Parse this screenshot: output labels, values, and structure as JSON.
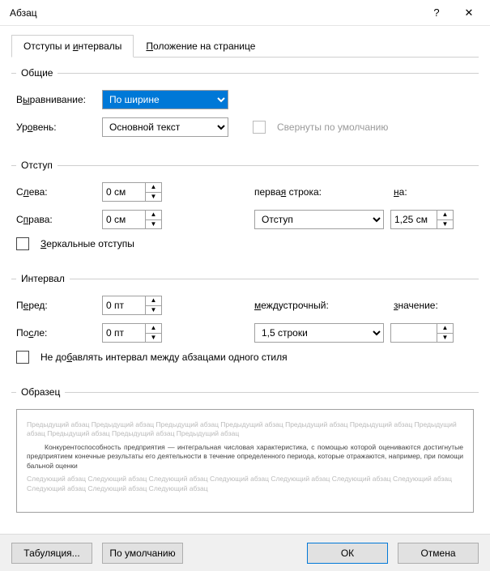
{
  "titlebar": {
    "title": "Абзац",
    "help": "?",
    "close": "✕"
  },
  "tabs": {
    "indents": {
      "pre": "Отступы и ",
      "u": "и",
      "post": "нтервалы"
    },
    "position": {
      "pre": "",
      "u": "П",
      "post": "оложение на странице"
    }
  },
  "general": {
    "legend": "Общие",
    "alignment_label": {
      "pre": "В",
      "u": "ы",
      "post": "равнивание:"
    },
    "alignment_value": "По ширине",
    "level_label": {
      "pre": "Ур",
      "u": "о",
      "post": "вень:"
    },
    "level_value": "Основной текст",
    "collapsed_label": "Свернуты по умолчанию"
  },
  "indent": {
    "legend": "Отступ",
    "left_label": {
      "pre": "С",
      "u": "л",
      "post": "ева:"
    },
    "left_value": "0 см",
    "right_label": {
      "pre": "С",
      "u": "п",
      "post": "рава:"
    },
    "right_value": "0 см",
    "first_label": {
      "pre": "перва",
      "u": "я",
      "post": " строка:"
    },
    "first_value": "Отступ",
    "by_label": {
      "pre": "",
      "u": "н",
      "post": "а:"
    },
    "by_value": "1,25 см",
    "mirror_label": {
      "pre": "",
      "u": "З",
      "post": "еркальные отступы"
    }
  },
  "spacing": {
    "legend": "Интервал",
    "before_label": {
      "pre": "П",
      "u": "е",
      "post": "ред:"
    },
    "before_value": "0 пт",
    "after_label": {
      "pre": "По",
      "u": "с",
      "post": "ле:"
    },
    "after_value": "0 пт",
    "line_label": {
      "pre": "",
      "u": "м",
      "post": "еждустрочный:"
    },
    "line_value": "1,5 строки",
    "value_label": {
      "pre": "",
      "u": "з",
      "post": "начение:"
    },
    "value_value": "",
    "no_space_label": {
      "pre": "Не до",
      "u": "б",
      "post": "авлять интервал между абзацами одного стиля"
    }
  },
  "preview": {
    "legend": "Образец",
    "prev_para": "Предыдущий абзац Предыдущий абзац Предыдущий абзац Предыдущий абзац Предыдущий абзац Предыдущий абзац Предыдущий абзац Предыдущий абзац Предыдущий абзац Предыдущий абзац",
    "main_text": "Конкурентоспособность предприятия — интегральная числовая характеристика, с помощью которой оцениваются достигнутые предприятием конечные результаты его деятельности в течение определенного периода, которые отражаются, например, при помощи бальной оценки",
    "next_para": "Следующий абзац Следующий абзац Следующий абзац Следующий абзац Следующий абзац Следующий абзац Следующий абзац Следующий абзац Следующий абзац Следующий абзац"
  },
  "footer": {
    "tabs": "Табуляция...",
    "default": "По умолчанию",
    "ok": "ОК",
    "cancel": "Отмена"
  }
}
